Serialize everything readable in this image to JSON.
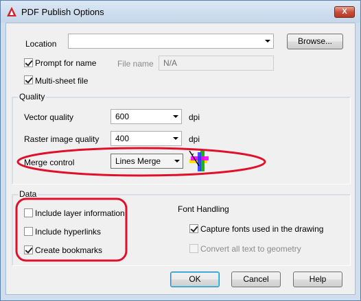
{
  "window": {
    "title": "PDF Publish Options",
    "close_label": "X"
  },
  "location": {
    "label": "Location",
    "value": "",
    "browse_label": "Browse..."
  },
  "prompt_for_name": {
    "label": "Prompt for name",
    "checked": true
  },
  "file_name": {
    "label": "File name",
    "value": "N/A"
  },
  "multi_sheet": {
    "label": "Multi-sheet file",
    "checked": true
  },
  "quality": {
    "title": "Quality",
    "vector_label": "Vector quality",
    "vector_value": "600",
    "vector_unit": "dpi",
    "raster_label": "Raster image quality",
    "raster_value": "400",
    "raster_unit": "dpi",
    "merge_label": "Merge control",
    "merge_value": "Lines Merge"
  },
  "data": {
    "title": "Data",
    "include_layer_label": "Include layer information",
    "include_hyperlinks_label": "Include hyperlinks",
    "create_bookmarks_label": "Create bookmarks"
  },
  "font_handling": {
    "title": "Font Handling",
    "capture_fonts_label": "Capture fonts used in the drawing",
    "convert_text_label": "Convert all text to geometry"
  },
  "buttons": {
    "ok": "OK",
    "cancel": "Cancel",
    "help": "Help"
  },
  "colors": {
    "annotation_red": "#e0102a",
    "accent_blue": "#3c7fb1"
  }
}
